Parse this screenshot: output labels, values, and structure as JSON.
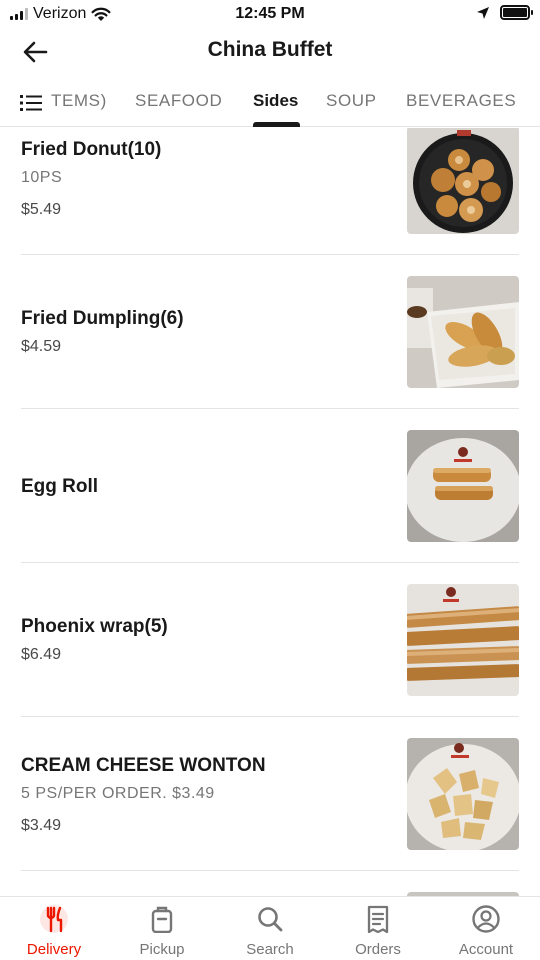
{
  "status_bar": {
    "carrier": "Verizon",
    "time": "12:45 PM",
    "battery_level": 1.0
  },
  "header": {
    "title": "China Buffet",
    "back_icon": "arrow-left-icon"
  },
  "tabs": {
    "menu_icon": "list-icon",
    "items": [
      {
        "label": "TEMS)",
        "active": false
      },
      {
        "label": "SEAFOOD",
        "active": false
      },
      {
        "label": "Sides",
        "active": true
      },
      {
        "label": "SOUP",
        "active": false
      },
      {
        "label": "BEVERAGES",
        "active": false
      }
    ]
  },
  "menu_items": [
    {
      "name": "Fried Donut(10)",
      "description": "10PS",
      "price": "$5.49"
    },
    {
      "name": "Fried Dumpling(6)",
      "price": "$4.59"
    },
    {
      "name": "Egg Roll"
    },
    {
      "name": "Phoenix wrap(5)",
      "price": "$6.49"
    },
    {
      "name": "CREAM CHEESE  WONTON",
      "description": "5 PS/PER ORDER.  $3.49",
      "price": "$3.49"
    }
  ],
  "bottom_nav": [
    {
      "label": "Delivery",
      "icon": "utensils-icon",
      "active": true
    },
    {
      "label": "Pickup",
      "icon": "bag-icon",
      "active": false
    },
    {
      "label": "Search",
      "icon": "search-icon",
      "active": false
    },
    {
      "label": "Orders",
      "icon": "receipt-icon",
      "active": false
    },
    {
      "label": "Account",
      "icon": "account-icon",
      "active": false
    }
  ],
  "colors": {
    "accent": "#eb1700",
    "text_primary": "#191919",
    "text_secondary": "#767676",
    "divider": "#e4e4e4"
  }
}
